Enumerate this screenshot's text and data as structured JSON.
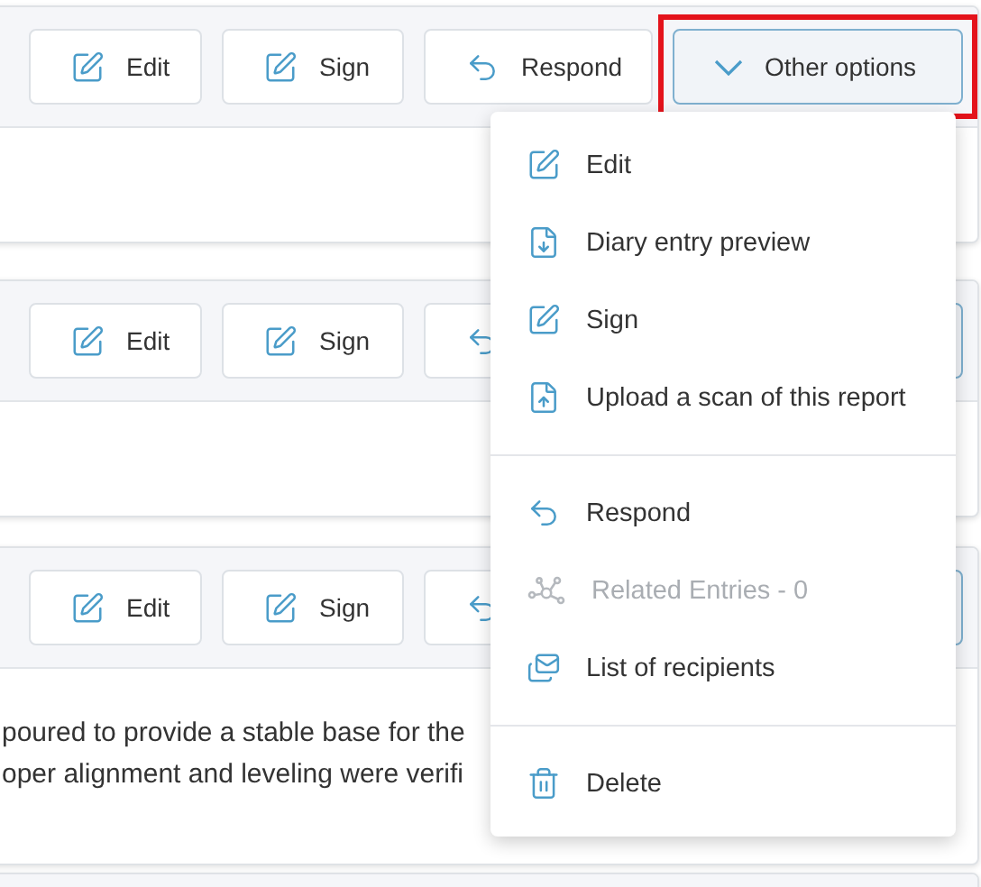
{
  "cards": [
    {
      "toolbar": [
        {
          "kind": "edit",
          "label": "Edit"
        },
        {
          "kind": "sign",
          "label": "Sign"
        },
        {
          "kind": "respond",
          "label": "Respond"
        },
        {
          "kind": "options",
          "label": "Other options",
          "highlighted": true
        }
      ]
    },
    {
      "toolbar": [
        {
          "kind": "edit",
          "label": "Edit"
        },
        {
          "kind": "sign",
          "label": "Sign"
        },
        {
          "kind": "respond"
        },
        {
          "kind": "options"
        }
      ]
    },
    {
      "toolbar": [
        {
          "kind": "edit",
          "label": "Edit"
        },
        {
          "kind": "sign",
          "label": "Sign"
        },
        {
          "kind": "respond"
        },
        {
          "kind": "options"
        }
      ],
      "body": [
        "poured to provide a stable base for the",
        "oper alignment and leveling were verifi"
      ]
    }
  ],
  "menu": {
    "groups": [
      [
        {
          "label": "Edit",
          "disabled": false
        },
        {
          "label": "Diary entry preview",
          "disabled": false
        },
        {
          "label": "Sign",
          "disabled": false
        },
        {
          "label": "Upload a scan of this report",
          "disabled": false
        }
      ],
      [
        {
          "label": "Respond",
          "disabled": false
        },
        {
          "label": "Related Entries - 0",
          "disabled": true
        },
        {
          "label": "List of recipients",
          "disabled": false
        }
      ],
      [
        {
          "label": "Delete",
          "disabled": false
        }
      ]
    ]
  }
}
